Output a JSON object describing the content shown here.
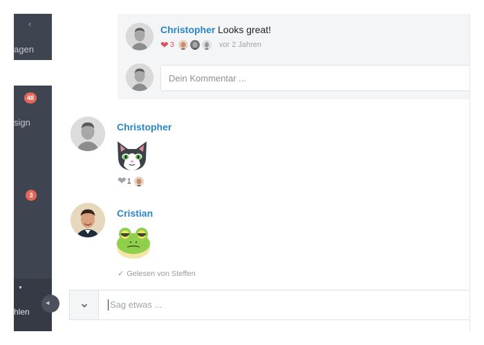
{
  "sidebar": {
    "back_icon": "chevron-left-icon",
    "item1_text": "agen",
    "badge1": "48",
    "item2_text": "sign",
    "badge2": "3",
    "bottom_caret": "caret-down-icon",
    "bottom_text": "hlen",
    "collapse_icon": "chevron-left-icon"
  },
  "thread_comment": {
    "author": "Christopher",
    "text": "Looks great!",
    "like_icon": "heart-icon",
    "like_count": "3",
    "time": "vor 2 Jahren",
    "comment_placeholder": "Dein Kommentar ..."
  },
  "messages": [
    {
      "author": "Christopher",
      "sticker": "cat-sticker",
      "like_icon": "heart-icon",
      "like_count": "1"
    },
    {
      "author": "Cristian",
      "sticker": "frog-sticker"
    }
  ],
  "read_receipt": {
    "icon": "checkmark-icon",
    "text": "Gelesen von Steffen"
  },
  "composer": {
    "toggle_icon": "chevron-down-icon",
    "placeholder": "Sag etwas ..."
  },
  "colors": {
    "sidebar_bg": "#3e4450",
    "link_blue": "#2b85c6",
    "badge_red": "#e4685a",
    "heart_red": "#e0515b",
    "panel_bg": "#f4f5f6"
  }
}
